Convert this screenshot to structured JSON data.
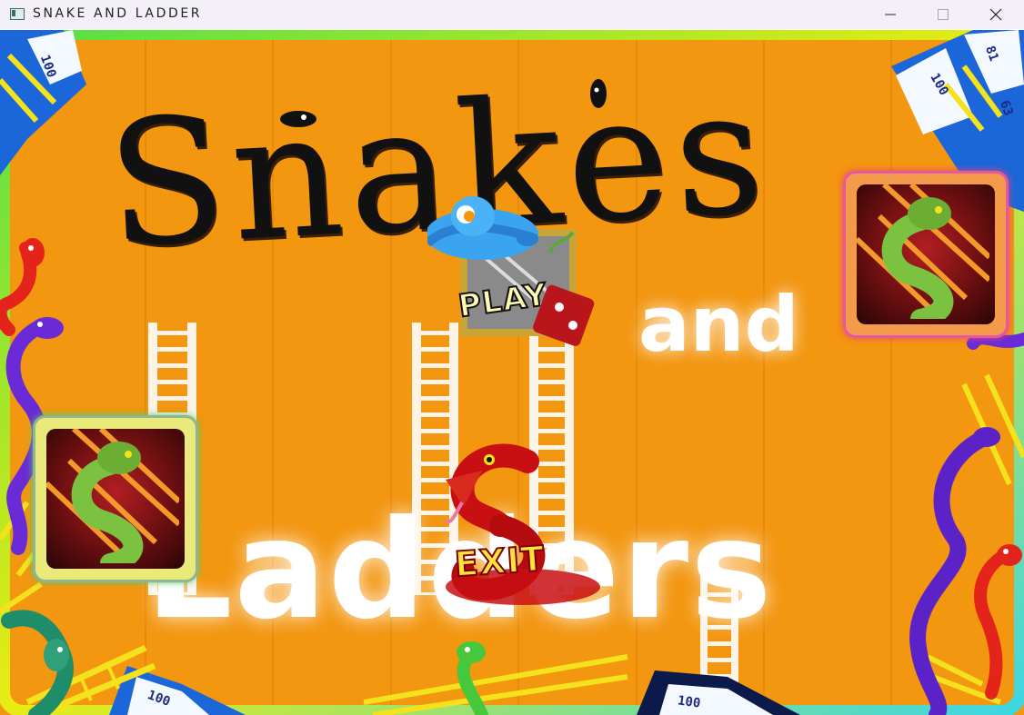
{
  "window": {
    "title": "SNAKE AND LADDER",
    "minimize_icon": "minimize-icon",
    "maximize_icon": "maximize-icon",
    "close_icon": "close-icon"
  },
  "menu": {
    "title_line1": "Snakes",
    "title_line2": "and",
    "title_line3": "Ladders",
    "play_label": "PLAY",
    "exit_label": "EXIT"
  },
  "board_numbers": {
    "top_left": "100",
    "top_right_a": "81",
    "top_right_b": "100",
    "top_right_c": "63",
    "bottom_left": "100",
    "bottom_right": "100"
  },
  "colors": {
    "background": "#f39610",
    "frame_glow": "#7cf000",
    "snake_red": "#e4231b",
    "snake_green": "#7cc241",
    "snake_purple": "#6a2bd6",
    "ladder_yellow": "#f4e21c"
  }
}
